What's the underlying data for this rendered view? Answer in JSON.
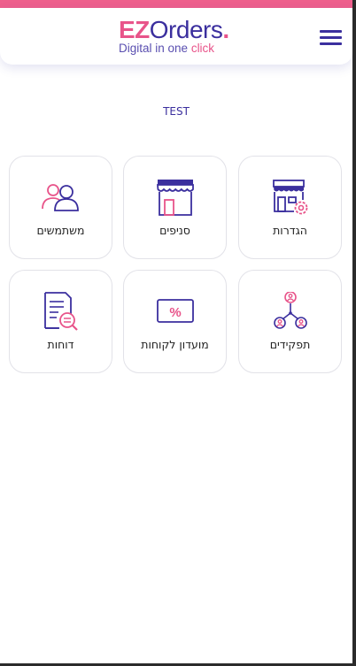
{
  "header": {
    "logo": {
      "part1": "EZ",
      "part2": "Orders",
      "dot": ".",
      "tagline_main": "Digital in one ",
      "tagline_accent": "click"
    },
    "menu_icon": "hamburger-menu-icon"
  },
  "store_name": "TEST",
  "tiles": [
    {
      "label": "הגדרות",
      "icon": "store-settings-icon"
    },
    {
      "label": "סניפים",
      "icon": "storefront-icon"
    },
    {
      "label": "משתמשים",
      "icon": "users-icon"
    },
    {
      "label": "תפקידים",
      "icon": "org-roles-icon"
    },
    {
      "label": "מועדון לקוחות",
      "icon": "discount-coupon-icon"
    },
    {
      "label": "דוחות",
      "icon": "report-search-icon"
    }
  ],
  "colors": {
    "primary": "#3b2f9e",
    "accent": "#e8548a",
    "top_bar": "#ee5f8c"
  }
}
